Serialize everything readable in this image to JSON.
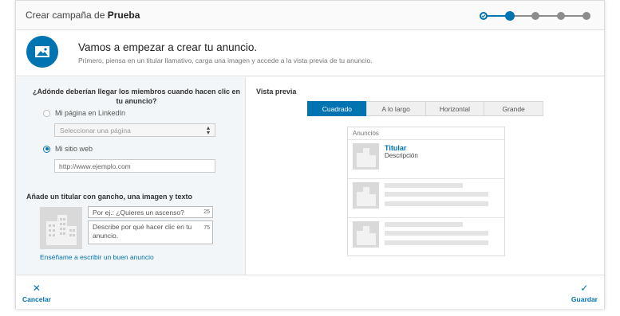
{
  "header": {
    "title_prefix": "Crear campaña de",
    "title_bold": "Prueba",
    "steps_total": 5,
    "current_step": 2
  },
  "intro": {
    "icon": "image-icon",
    "heading": "Vamos a empezar a crear tu anuncio.",
    "subtext": "Primero, piensa en un titular llamativo, carga una imagen y accede a la vista previa de tu anuncio."
  },
  "destination": {
    "question": "¿Adónde deberían llegar los miembros cuando hacen clic en tu anuncio?",
    "option_linkedin": "Mi página en LinkedIn",
    "page_select_placeholder": "Seleccionar una página",
    "option_website": "Mi sitio web",
    "website_value": "http://www.ejemplo.com",
    "selected": "website"
  },
  "creative": {
    "section_title": "Añade un titular con gancho, una imagen y texto",
    "headline_placeholder": "Por ej.: ¿Quieres un ascenso?",
    "headline_count": "25",
    "description_placeholder": "Describe por qué hacer clic en tu anuncio.",
    "description_count": "75",
    "teach_link": "Enséñame a escribir un buen anuncio"
  },
  "preview": {
    "title": "Vista previa",
    "tabs": [
      "Cuadrado",
      "A lo largo",
      "Horizontal",
      "Grande"
    ],
    "active_tab": "Cuadrado",
    "card_header": "Anuncios",
    "ad_title": "Titular",
    "ad_description": "Descripción"
  },
  "footer": {
    "cancel_label": "Cancelar",
    "save_label": "Guardar"
  },
  "colors": {
    "accent": "#0073b1",
    "inactive_step": "#8c8c8c"
  }
}
